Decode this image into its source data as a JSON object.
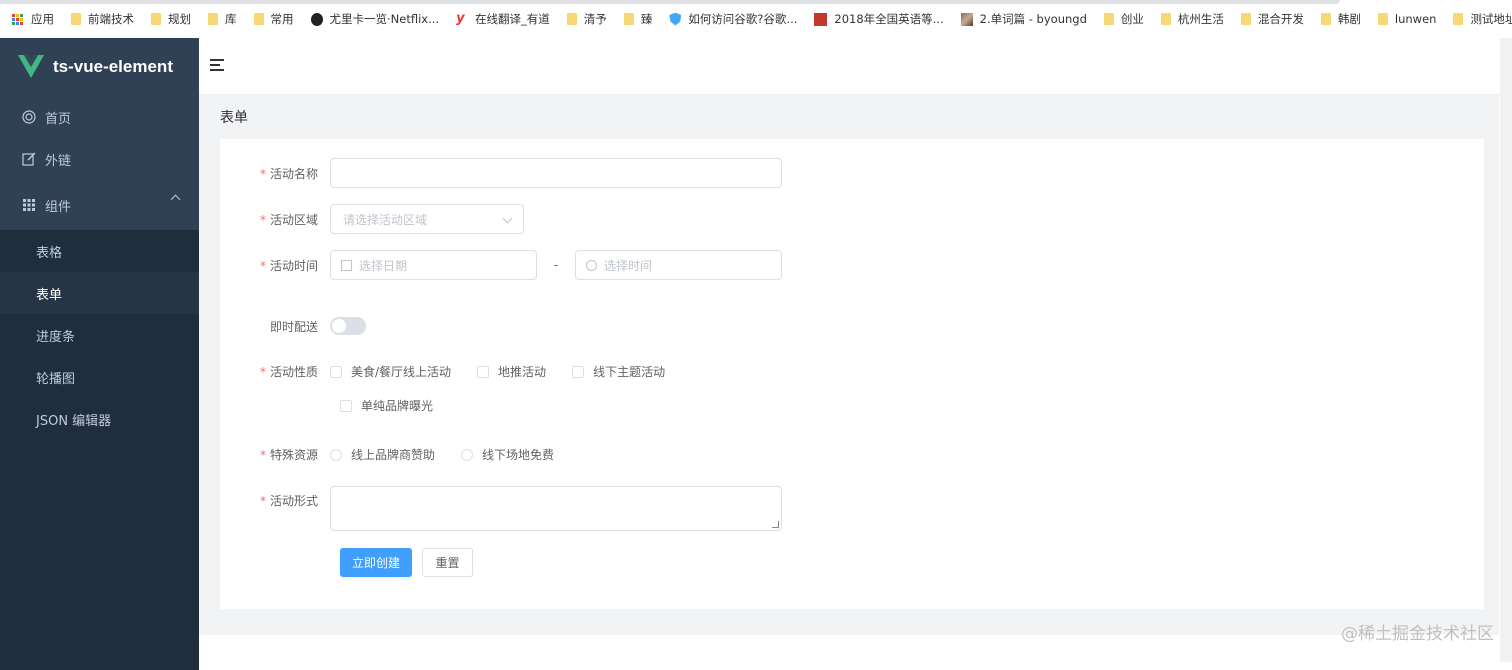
{
  "bookmarks": [
    {
      "icon": "apps-icon",
      "label": "应用"
    },
    {
      "icon": "folder-icon",
      "label": "前端技术"
    },
    {
      "icon": "folder-icon",
      "label": "规划"
    },
    {
      "icon": "folder-icon",
      "label": "库"
    },
    {
      "icon": "folder-icon",
      "label": "常用"
    },
    {
      "icon": "github-icon",
      "label": "尤里卡一览·Netflix..."
    },
    {
      "icon": "youdao-icon",
      "label": "在线翻译_有道"
    },
    {
      "icon": "folder-icon",
      "label": "清予"
    },
    {
      "icon": "folder-icon",
      "label": "臻"
    },
    {
      "icon": "shield-icon",
      "label": "如何访问谷歌?谷歌..."
    },
    {
      "icon": "red-square-icon",
      "label": "2018年全国英语等..."
    },
    {
      "icon": "photo-icon",
      "label": "2.单词篇 - byoungd"
    },
    {
      "icon": "folder-icon",
      "label": "创业"
    },
    {
      "icon": "folder-icon",
      "label": "杭州生活"
    },
    {
      "icon": "folder-icon",
      "label": "混合开发"
    },
    {
      "icon": "folder-icon",
      "label": "韩剧"
    },
    {
      "icon": "folder-icon",
      "label": "lunwen"
    },
    {
      "icon": "folder-icon",
      "label": "测试地址"
    }
  ],
  "sidebar": {
    "brand": "ts-vue-element",
    "items": [
      {
        "label": "首页",
        "icon": "dashboard-icon"
      },
      {
        "label": "外链",
        "icon": "edit-link-icon"
      },
      {
        "label": "组件",
        "icon": "grid-icon"
      }
    ],
    "sub_items": [
      {
        "label": "表格"
      },
      {
        "label": "表单"
      },
      {
        "label": "进度条"
      },
      {
        "label": "轮播图"
      },
      {
        "label": "JSON 编辑器"
      }
    ],
    "active": "表单"
  },
  "page": {
    "title": "表单"
  },
  "form": {
    "name_label": "活动名称",
    "name_value": "",
    "region_label": "活动区域",
    "region_placeholder": "请选择活动区域",
    "time_label": "活动时间",
    "date_placeholder": "选择日期",
    "time_separator": "-",
    "time_placeholder": "选择时间",
    "delivery_label": "即时配送",
    "delivery_on": false,
    "type_label": "活动性质",
    "type_options": [
      "美食/餐厅线上活动",
      "地推活动",
      "线下主题活动",
      "单纯品牌曝光"
    ],
    "resource_label": "特殊资源",
    "resource_options": [
      "线上品牌商赞助",
      "线下场地免费"
    ],
    "desc_label": "活动形式",
    "submit_label": "立即创建",
    "reset_label": "重置",
    "required_mark": "*"
  },
  "watermark": "@稀土掘金技术社区",
  "colors": {
    "sidebar": "#304156",
    "primary": "#409eff",
    "required": "#f56c6c"
  }
}
